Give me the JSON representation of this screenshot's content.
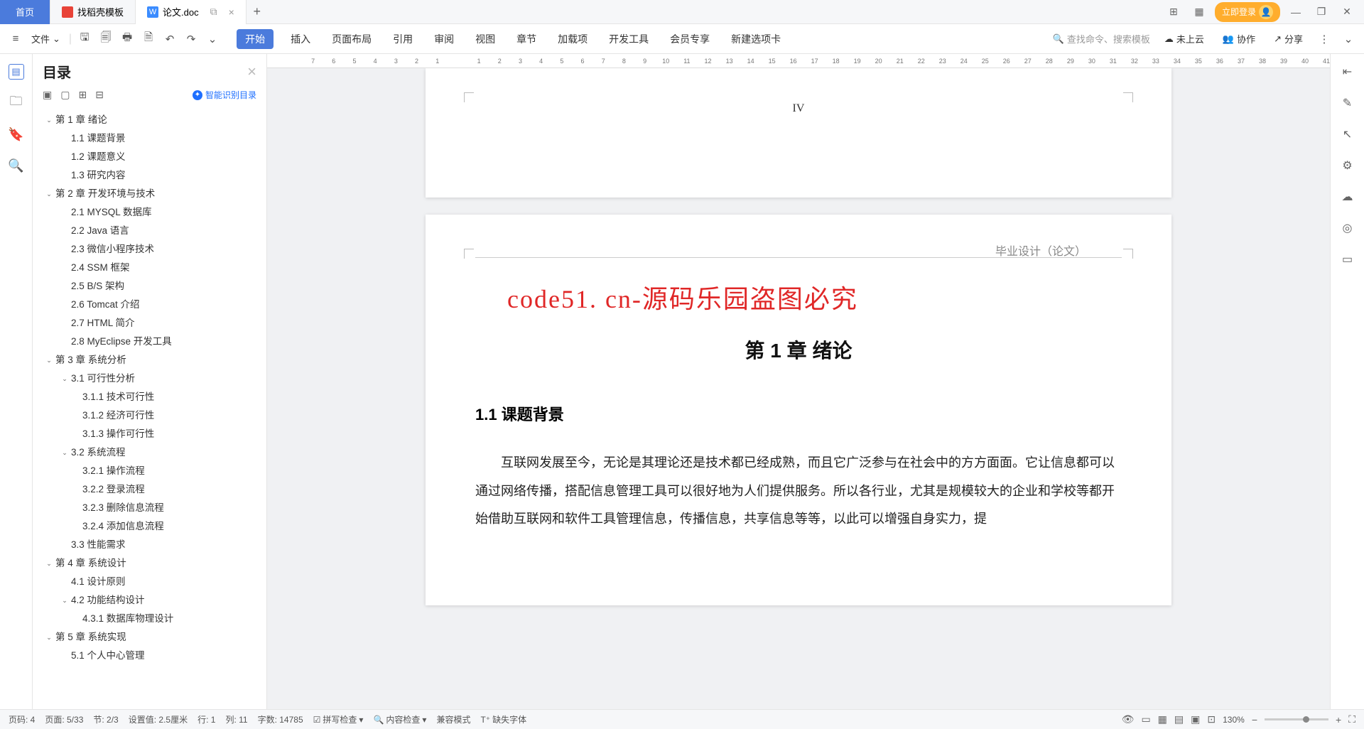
{
  "tabs": {
    "home": "首页",
    "tpl": "找稻壳模板",
    "doc": "论文.doc"
  },
  "winctrl": {
    "login": "立即登录"
  },
  "menu": {
    "file": "文件"
  },
  "ribbon": {
    "start": "开始",
    "insert": "插入",
    "layout": "页面布局",
    "ref": "引用",
    "review": "审阅",
    "view": "视图",
    "chapter": "章节",
    "addon": "加载项",
    "dev": "开发工具",
    "member": "会员专享",
    "newtab": "新建选项卡"
  },
  "search": {
    "placeholder": "查找命令、搜索模板"
  },
  "cloud": {
    "notup": "未上云",
    "collab": "协作",
    "share": "分享"
  },
  "outline": {
    "title": "目录",
    "smart": "智能识别目录",
    "items": [
      {
        "lvl": 1,
        "c": true,
        "t": "第 1 章  绪论"
      },
      {
        "lvl": 2,
        "c": false,
        "t": "1.1  课题背景"
      },
      {
        "lvl": 2,
        "c": false,
        "t": "1.2  课题意义"
      },
      {
        "lvl": 2,
        "c": false,
        "t": "1.3  研究内容"
      },
      {
        "lvl": 1,
        "c": true,
        "t": "第 2 章  开发环境与技术"
      },
      {
        "lvl": 2,
        "c": false,
        "t": "2.1  MYSQL 数据库"
      },
      {
        "lvl": 2,
        "c": false,
        "t": "2.2  Java 语言"
      },
      {
        "lvl": 2,
        "c": false,
        "t": "2.3  微信小程序技术"
      },
      {
        "lvl": 2,
        "c": false,
        "t": "2.4  SSM 框架"
      },
      {
        "lvl": 2,
        "c": false,
        "t": "2.5  B/S 架构"
      },
      {
        "lvl": 2,
        "c": false,
        "t": "2.6  Tomcat  介绍"
      },
      {
        "lvl": 2,
        "c": false,
        "t": "2.7  HTML 简介"
      },
      {
        "lvl": 2,
        "c": false,
        "t": "2.8  MyEclipse 开发工具"
      },
      {
        "lvl": 1,
        "c": true,
        "t": "第 3 章  系统分析"
      },
      {
        "lvl": 2,
        "c": true,
        "t": "3.1  可行性分析"
      },
      {
        "lvl": 3,
        "c": false,
        "t": "3.1.1  技术可行性"
      },
      {
        "lvl": 3,
        "c": false,
        "t": "3.1.2  经济可行性"
      },
      {
        "lvl": 3,
        "c": false,
        "t": "3.1.3  操作可行性"
      },
      {
        "lvl": 2,
        "c": true,
        "t": "3.2  系统流程"
      },
      {
        "lvl": 3,
        "c": false,
        "t": "3.2.1  操作流程"
      },
      {
        "lvl": 3,
        "c": false,
        "t": "3.2.2  登录流程"
      },
      {
        "lvl": 3,
        "c": false,
        "t": "3.2.3  删除信息流程"
      },
      {
        "lvl": 3,
        "c": false,
        "t": "3.2.4  添加信息流程"
      },
      {
        "lvl": 2,
        "c": false,
        "t": "3.3  性能需求"
      },
      {
        "lvl": 1,
        "c": true,
        "t": "第 4 章  系统设计"
      },
      {
        "lvl": 2,
        "c": false,
        "t": "4.1  设计原则"
      },
      {
        "lvl": 2,
        "c": true,
        "t": "4.2  功能结构设计"
      },
      {
        "lvl": 3,
        "c": false,
        "t": "4.3.1 数据库物理设计"
      },
      {
        "lvl": 1,
        "c": true,
        "t": "第 5 章  系统实现"
      },
      {
        "lvl": 2,
        "c": false,
        "t": "5.1 个人中心管理"
      }
    ]
  },
  "ruler": [
    "7",
    "6",
    "5",
    "4",
    "3",
    "2",
    "1",
    "",
    "1",
    "2",
    "3",
    "4",
    "5",
    "6",
    "7",
    "8",
    "9",
    "10",
    "11",
    "12",
    "13",
    "14",
    "15",
    "16",
    "17",
    "18",
    "19",
    "20",
    "21",
    "22",
    "23",
    "24",
    "25",
    "26",
    "27",
    "28",
    "29",
    "30",
    "31",
    "32",
    "33",
    "34",
    "35",
    "36",
    "37",
    "38",
    "39",
    "40",
    "41"
  ],
  "doc": {
    "prevPageNum": "IV",
    "header": "毕业设计（论文）",
    "watermark": "code51. cn-源码乐园盗图必究",
    "chapter": "第 1 章  绪论",
    "section": "1.1  课题背景",
    "para": "互联网发展至今，无论是其理论还是技术都已经成熟，而且它广泛参与在社会中的方方面面。它让信息都可以通过网络传播，搭配信息管理工具可以很好地为人们提供服务。所以各行业，尤其是规模较大的企业和学校等都开始借助互联网和软件工具管理信息，传播信息，共享信息等等，以此可以增强自身实力，提"
  },
  "status": {
    "page": "页码: 4",
    "pages": "页面: 5/33",
    "sec": "节: 2/3",
    "setval": "设置值: 2.5厘米",
    "row": "行: 1",
    "col": "列: 11",
    "words": "字数: 14785",
    "spell": "拼写检查",
    "content": "内容检查",
    "compat": "兼容模式",
    "missing": "缺失字体",
    "zoom": "130%"
  }
}
